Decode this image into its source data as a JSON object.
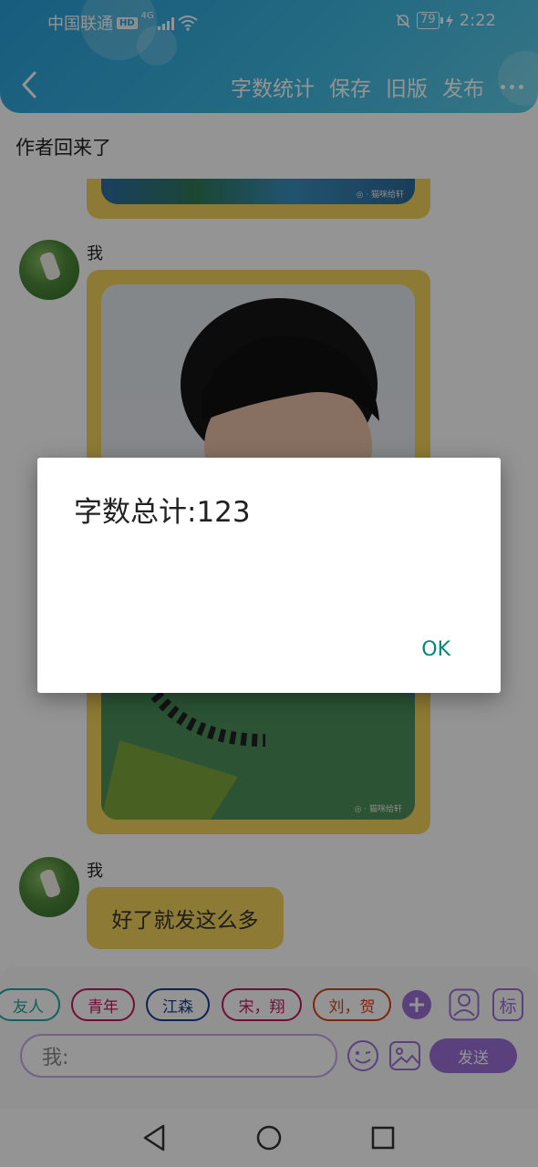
{
  "status_bar": {
    "carrier": "中国联通",
    "hd": "HD",
    "network": "4G",
    "battery": "79",
    "time": "2:22"
  },
  "nav": {
    "actions": [
      "字数统计",
      "保存",
      "旧版",
      "发布"
    ]
  },
  "document": {
    "title": "作者回来了"
  },
  "messages": [
    {
      "sender": "我",
      "type": "image"
    },
    {
      "sender": "我",
      "type": "text",
      "text": "好了就发这么多"
    }
  ],
  "watermark": "◎ · 猫咪给轩",
  "tags": [
    {
      "label": "友人",
      "color": "#21a6a0"
    },
    {
      "label": "青年",
      "color": "#c2185b"
    },
    {
      "label": "江森",
      "color": "#1a3b8f"
    },
    {
      "label": "宋，翔",
      "color": "#c2185b"
    },
    {
      "label": "刘，贺",
      "color": "#d84315"
    }
  ],
  "input": {
    "placeholder": "我:",
    "send_label": "发送",
    "mark_label": "标"
  },
  "dialog": {
    "message": "字数总计:123",
    "ok_label": "OK"
  },
  "colors": {
    "header": "#2aa0d8",
    "card": "#f3d35a",
    "accent_purple": "#9b6fd8",
    "dialog_ok": "#00897b"
  }
}
